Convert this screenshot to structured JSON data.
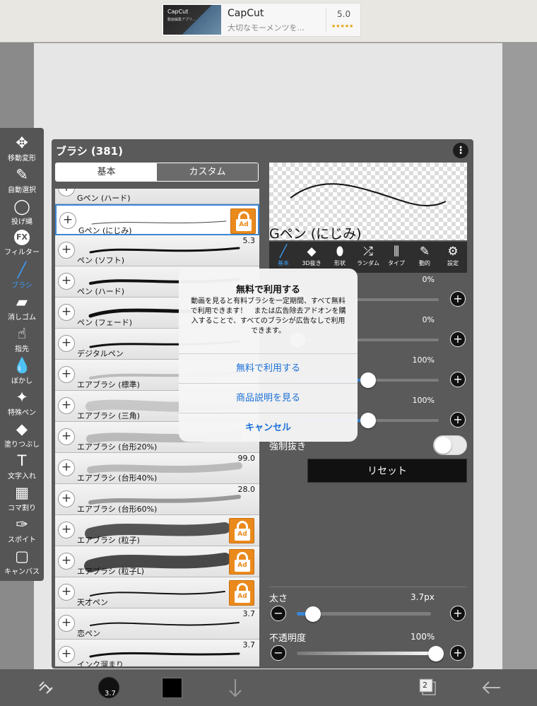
{
  "ad": {
    "app_name": "CapCut",
    "subtitle": "大切なモーメンツを...",
    "rating": "5.0",
    "stars": "★★★★★",
    "thumb_title": "CapCut",
    "thumb_text": "動画編集アプリ..."
  },
  "toolbar": {
    "items": [
      {
        "label": "移動変形",
        "icon": "move-icon",
        "glyph": "✥"
      },
      {
        "label": "自動選択",
        "icon": "magic-wand-icon",
        "glyph": "✎"
      },
      {
        "label": "投げ縄",
        "icon": "lasso-icon",
        "glyph": "◯"
      },
      {
        "label": "フィルター",
        "icon": "fx-icon",
        "glyph": "FX"
      },
      {
        "label": "ブラシ",
        "icon": "brush-icon",
        "glyph": "╱",
        "active": true
      },
      {
        "label": "消しゴム",
        "icon": "eraser-icon",
        "glyph": "▰"
      },
      {
        "label": "指先",
        "icon": "finger-icon",
        "glyph": "☝"
      },
      {
        "label": "ぼかし",
        "icon": "blur-icon",
        "glyph": "💧"
      },
      {
        "label": "特殊ペン",
        "icon": "special-pen-icon",
        "glyph": "✦"
      },
      {
        "label": "塗りつぶし",
        "icon": "fill-icon",
        "glyph": "◆"
      },
      {
        "label": "文字入れ",
        "icon": "text-icon",
        "glyph": "T"
      },
      {
        "label": "コマ割り",
        "icon": "frame-divide-icon",
        "glyph": "▦"
      },
      {
        "label": "スポイト",
        "icon": "eyedropper-icon",
        "glyph": "✑"
      },
      {
        "label": "キャンバス",
        "icon": "canvas-icon",
        "glyph": "▢"
      }
    ]
  },
  "panel": {
    "title": "ブラシ (381)",
    "menu_glyph": "⋮",
    "tab_basic": "基本",
    "tab_custom": "カスタム",
    "brushes": [
      {
        "name": "Gペン (ハード)",
        "size": "",
        "locked": false
      },
      {
        "name": "Gペン (にじみ)",
        "size": "",
        "locked": true,
        "selected": true
      },
      {
        "name": "ペン (ソフト)",
        "size": "5.3",
        "locked": false
      },
      {
        "name": "ペン (ハード)",
        "size": "",
        "locked": false
      },
      {
        "name": "ペン (フェード)",
        "size": "",
        "locked": false
      },
      {
        "name": "デジタルペン",
        "size": "",
        "locked": false
      },
      {
        "name": "エアブラシ (標準)",
        "size": "",
        "locked": false
      },
      {
        "name": "エアブラシ (三角)",
        "size": "",
        "locked": false
      },
      {
        "name": "エアブラシ (台形20%)",
        "size": "",
        "locked": false
      },
      {
        "name": "エアブラシ (台形40%)",
        "size": "99.0",
        "locked": false
      },
      {
        "name": "エアブラシ (台形60%)",
        "size": "28.0",
        "locked": false
      },
      {
        "name": "エアブラシ (粒子)",
        "size": "",
        "locked": true
      },
      {
        "name": "エアブラシ (粒子L)",
        "size": "",
        "locked": true
      },
      {
        "name": "天才ペン",
        "size": "",
        "locked": true
      },
      {
        "name": "恋ペン",
        "size": "3.7",
        "locked": false
      },
      {
        "name": "インク溜まり",
        "size": "3.7",
        "locked": false
      }
    ],
    "ad_label": "Ad",
    "preview_name": "Gペン (にじみ)",
    "prop_tabs": [
      {
        "label": "基本",
        "icon": "brush-basic-icon",
        "glyph": "╱",
        "active": true
      },
      {
        "label": "3D抜き",
        "icon": "3d-icon",
        "glyph": "◆"
      },
      {
        "label": "形状",
        "icon": "shape-icon",
        "glyph": "⬮"
      },
      {
        "label": "ランダム",
        "icon": "shuffle-icon",
        "glyph": "⤮"
      },
      {
        "label": "タイプ",
        "icon": "type-icon",
        "glyph": "⫼"
      },
      {
        "label": "動的",
        "icon": "dynamic-icon",
        "glyph": "✎"
      },
      {
        "label": "設定",
        "icon": "settings-icon",
        "glyph": "⚙"
      }
    ],
    "sliders": [
      {
        "value": "0%",
        "fraction": 0.0
      },
      {
        "value": "0%",
        "fraction": 0.0
      },
      {
        "value": "100%",
        "fraction": 0.5
      },
      {
        "value": "100%",
        "fraction": 0.5
      }
    ],
    "forced_label": "強制抜き",
    "reset_label": "リセット",
    "thickness_label": "太さ",
    "thickness_value": "3.7px",
    "opacity_label": "不透明度",
    "opacity_value": "100%",
    "minus": "−",
    "plus": "+"
  },
  "dialog": {
    "title": "無料で利用する",
    "message": "動画を見ると有料ブラシを一定期間、すべて無料で利用できます！　または広告除去アドオンを購入することで、すべてのブラシが広告なしで利用できます。",
    "btn_free": "無料で利用する",
    "btn_details": "商品説明を見る",
    "btn_cancel": "キャンセル"
  },
  "bottom": {
    "brush_size": "3.7",
    "layer_count": "2"
  }
}
